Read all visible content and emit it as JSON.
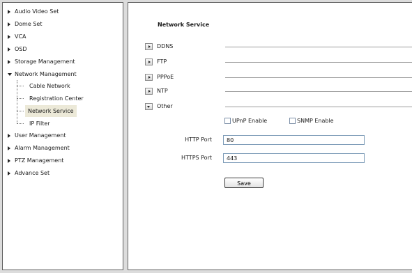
{
  "sidebar": {
    "top_items": [
      {
        "label": "Audio Video Set"
      },
      {
        "label": "Dome Set"
      },
      {
        "label": "VCA"
      },
      {
        "label": "OSD"
      },
      {
        "label": "Storage Management"
      },
      {
        "label": "Network Management"
      }
    ],
    "sub_items": [
      {
        "label": "Cable Network"
      },
      {
        "label": "Registration Center"
      },
      {
        "label": "Network Service"
      },
      {
        "label": "IP Filter"
      }
    ],
    "bottom_items": [
      {
        "label": "User Management"
      },
      {
        "label": "Alarm Management"
      },
      {
        "label": "PTZ Management"
      },
      {
        "label": "Advance Set"
      }
    ],
    "active_sub": "Network Service"
  },
  "main": {
    "title": "Network Service",
    "sections": [
      {
        "label": "DDNS",
        "expanded": false
      },
      {
        "label": "FTP",
        "expanded": false
      },
      {
        "label": "PPPoE",
        "expanded": false
      },
      {
        "label": "NTP",
        "expanded": false
      },
      {
        "label": "Other",
        "expanded": true
      }
    ],
    "upnp": {
      "label": "UPnP Enable",
      "checked": false
    },
    "snmp": {
      "label": "SNMP Enable",
      "checked": false
    },
    "http_port": {
      "label": "HTTP Port",
      "value": "80"
    },
    "https_port": {
      "label": "HTTPS Port",
      "value": "443"
    },
    "save_label": "Save"
  }
}
